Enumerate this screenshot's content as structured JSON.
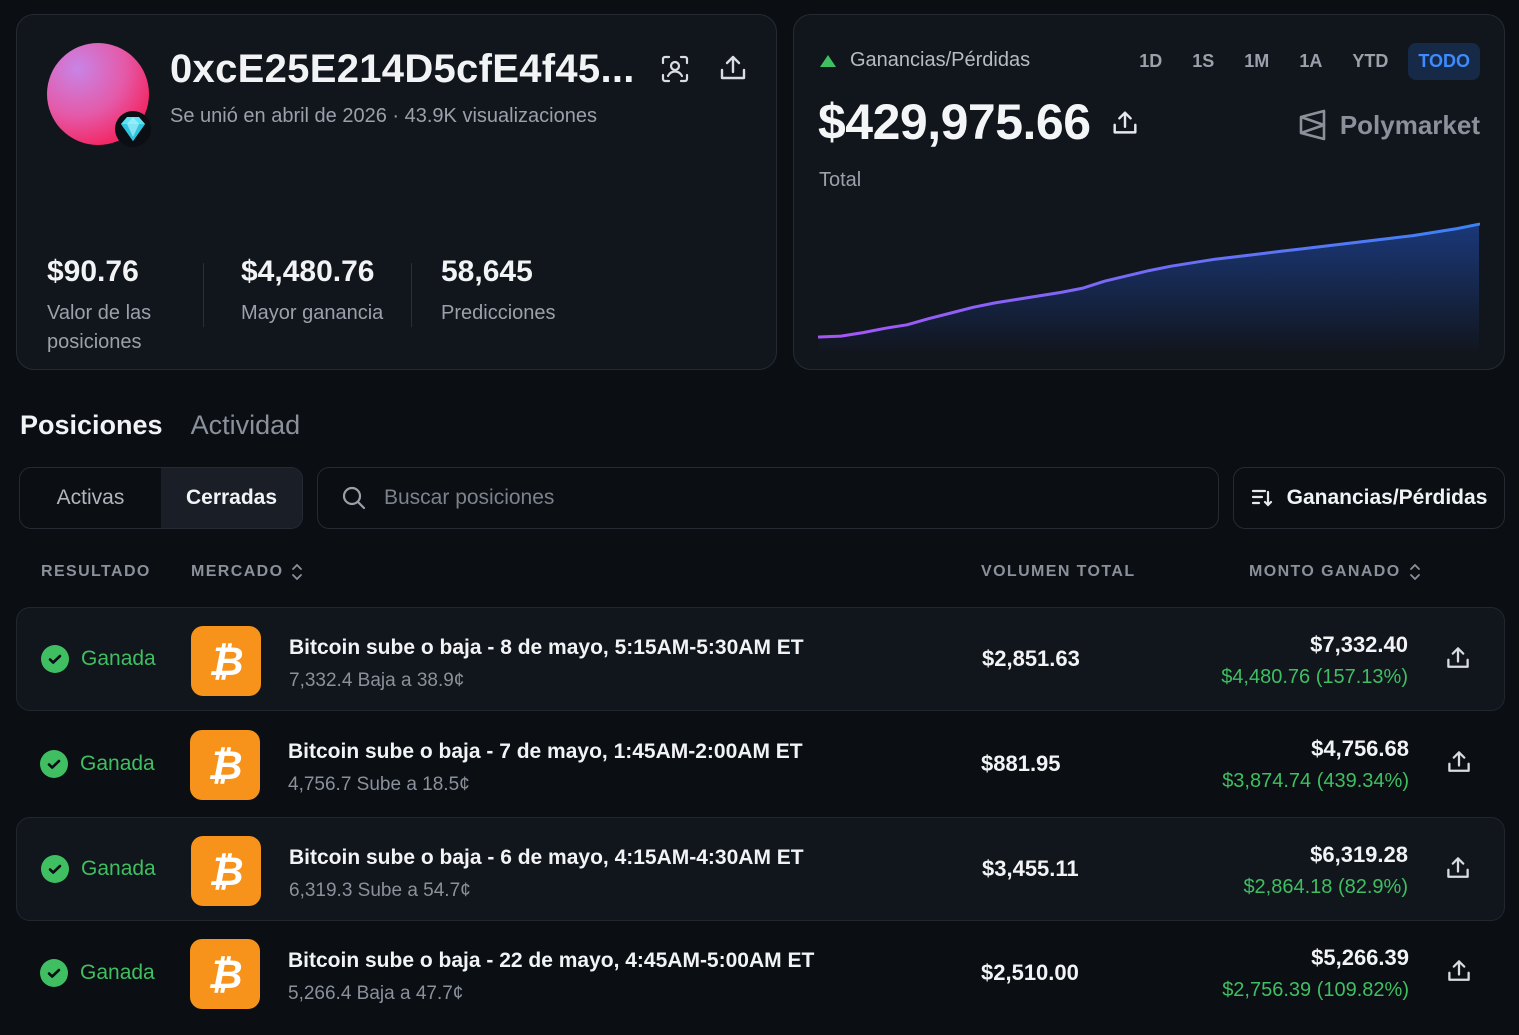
{
  "profile": {
    "address": "0xcE25E214D5cfE4f45...",
    "joined": "Se unió en abril de 2026",
    "views": "43.9K visualizaciones",
    "stats": [
      {
        "value": "$90.76",
        "label": "Valor de las posiciones"
      },
      {
        "value": "$4,480.76",
        "label": "Mayor ganancia"
      },
      {
        "value": "58,645",
        "label": "Predicciones"
      }
    ]
  },
  "pnl": {
    "title": "Ganancias/Pérdidas",
    "ranges": [
      "1D",
      "1S",
      "1M",
      "1A",
      "YTD",
      "TODO"
    ],
    "active_range": "TODO",
    "value": "$429,975.66",
    "subtitle": "Total",
    "brand": "Polymarket",
    "colors": {
      "up": "#3fbf62",
      "line_start": "#a855f7",
      "line_end": "#3b82f6"
    }
  },
  "chart_data": {
    "type": "area",
    "x": [
      0,
      1,
      2,
      3,
      4,
      5,
      6,
      7,
      8,
      9,
      10,
      11,
      12,
      13,
      14,
      15,
      16,
      17,
      18,
      19,
      20,
      21,
      22,
      23,
      24,
      25,
      26,
      27,
      28,
      29,
      30
    ],
    "values": [
      0,
      2,
      10,
      20,
      28,
      42,
      55,
      68,
      78,
      86,
      94,
      102,
      112,
      128,
      140,
      152,
      162,
      170,
      178,
      184,
      190,
      196,
      202,
      208,
      214,
      220,
      226,
      232,
      240,
      248,
      258
    ],
    "title": "",
    "xlabel": "",
    "ylabel": "",
    "ylim": [
      0,
      270
    ],
    "grid": false
  },
  "tabs": {
    "items": [
      "Posiciones",
      "Actividad"
    ],
    "active": "Posiciones"
  },
  "filters": {
    "segments": [
      "Activas",
      "Cerradas"
    ],
    "active": "Cerradas"
  },
  "search": {
    "placeholder": "Buscar posiciones"
  },
  "sort": {
    "label": "Ganancias/Pérdidas"
  },
  "table": {
    "headers": {
      "result": "RESULTADO",
      "market": "MERCADO",
      "volume": "VOLUMEN TOTAL",
      "amount": "MONTO GANADO"
    },
    "rows": [
      {
        "result": "Ganada",
        "title": "Bitcoin sube o baja - 8 de mayo, 5:15AM-5:30AM ET",
        "sub": "7,332.4 Baja a 38.9¢",
        "volume": "$2,851.63",
        "amount": "$7,332.40",
        "gain": "$4,480.76 (157.13%)"
      },
      {
        "result": "Ganada",
        "title": "Bitcoin sube o baja - 7 de mayo, 1:45AM-2:00AM ET",
        "sub": "4,756.7 Sube a 18.5¢",
        "volume": "$881.95",
        "amount": "$4,756.68",
        "gain": "$3,874.74 (439.34%)"
      },
      {
        "result": "Ganada",
        "title": "Bitcoin sube o baja - 6 de mayo, 4:15AM-4:30AM ET",
        "sub": "6,319.3 Sube a 54.7¢",
        "volume": "$3,455.11",
        "amount": "$6,319.28",
        "gain": "$2,864.18 (82.9%)"
      },
      {
        "result": "Ganada",
        "title": "Bitcoin sube o baja - 22 de mayo, 4:45AM-5:00AM ET",
        "sub": "5,266.4 Baja a 47.7¢",
        "volume": "$2,510.00",
        "amount": "$5,266.39",
        "gain": "$2,756.39 (109.82%)"
      }
    ]
  },
  "icons": {
    "scan": "scan-face-icon",
    "share": "share-icon",
    "search": "search-icon",
    "sort": "sort-icon",
    "sort_toggle": "chevron-updown-icon",
    "check": "check-circle-icon",
    "bitcoin": "bitcoin-icon",
    "gem": "diamond-icon",
    "brand": "polymarket-logo-icon"
  }
}
